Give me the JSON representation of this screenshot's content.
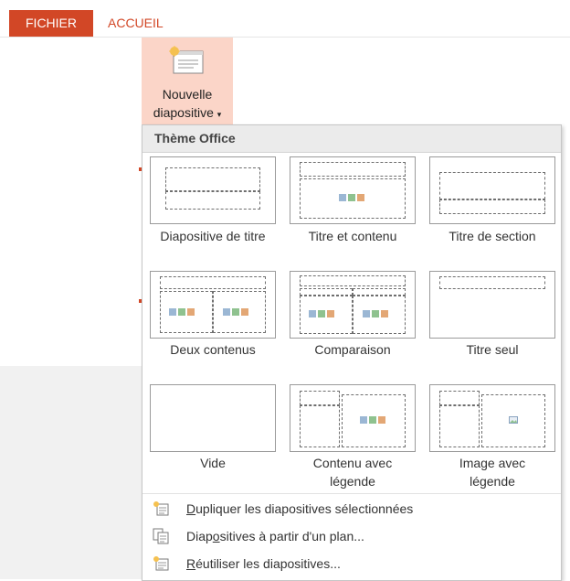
{
  "ribbon": {
    "tabs": [
      {
        "label": "FICHIER"
      },
      {
        "label": "ACCUEIL"
      }
    ],
    "new_slide_button": {
      "line1": "Nouvelle",
      "line2": "diapositive",
      "caret": "▾"
    }
  },
  "menu": {
    "title": "Thème Office",
    "layouts": [
      {
        "label": "Diapositive de titre",
        "lines": [
          "Diapositive de titre"
        ]
      },
      {
        "label": "Titre et contenu",
        "lines": [
          "Titre et contenu"
        ]
      },
      {
        "label": "Titre de section",
        "lines": [
          "Titre de section"
        ]
      },
      {
        "label": "Deux contenus",
        "lines": [
          "Deux contenus"
        ]
      },
      {
        "label": "Comparaison",
        "lines": [
          "Comparaison"
        ]
      },
      {
        "label": "Titre seul",
        "lines": [
          "Titre seul"
        ]
      },
      {
        "label": "Vide",
        "lines": [
          "Vide"
        ]
      },
      {
        "label": "Contenu avec légende",
        "lines": [
          "Contenu avec",
          "légende"
        ]
      },
      {
        "label": "Image avec légende",
        "lines": [
          "Image avec",
          "légende"
        ]
      }
    ],
    "commands": [
      {
        "label": "Dupliquer les diapositives sélectionnées",
        "prefix": "",
        "hotkey": "D",
        "suffix": "upliquer les diapositives sélectionnées",
        "icon": "duplicate-slides-icon"
      },
      {
        "label": "Diapositives à partir d'un plan...",
        "prefix": "Diap",
        "hotkey": "o",
        "suffix": "sitives à partir d'un plan...",
        "icon": "slides-from-outline-icon"
      },
      {
        "label": "Réutiliser les diapositives...",
        "prefix": "",
        "hotkey": "R",
        "suffix": "éutiliser les diapositives...",
        "icon": "reuse-slides-icon"
      }
    ]
  },
  "colors": {
    "accent": "#d24726",
    "button_highlight": "#fbd5c8",
    "header_bg": "#ebebeb"
  }
}
